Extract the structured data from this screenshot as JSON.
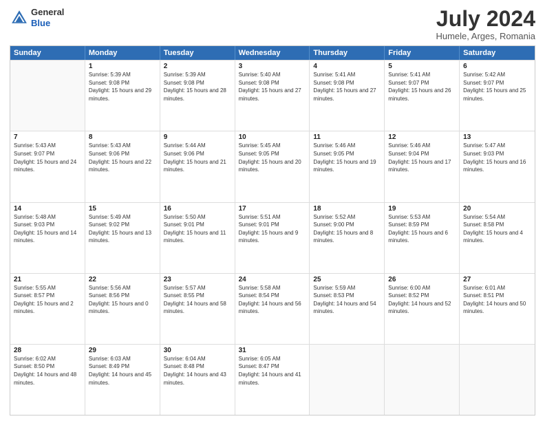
{
  "logo": {
    "line1": "General",
    "line2": "Blue"
  },
  "title": "July 2024",
  "location": "Humele, Arges, Romania",
  "days": [
    "Sunday",
    "Monday",
    "Tuesday",
    "Wednesday",
    "Thursday",
    "Friday",
    "Saturday"
  ],
  "weeks": [
    [
      {
        "day": "",
        "sunrise": "",
        "sunset": "",
        "daylight": ""
      },
      {
        "day": "1",
        "sunrise": "Sunrise: 5:39 AM",
        "sunset": "Sunset: 9:08 PM",
        "daylight": "Daylight: 15 hours and 29 minutes."
      },
      {
        "day": "2",
        "sunrise": "Sunrise: 5:39 AM",
        "sunset": "Sunset: 9:08 PM",
        "daylight": "Daylight: 15 hours and 28 minutes."
      },
      {
        "day": "3",
        "sunrise": "Sunrise: 5:40 AM",
        "sunset": "Sunset: 9:08 PM",
        "daylight": "Daylight: 15 hours and 27 minutes."
      },
      {
        "day": "4",
        "sunrise": "Sunrise: 5:41 AM",
        "sunset": "Sunset: 9:08 PM",
        "daylight": "Daylight: 15 hours and 27 minutes."
      },
      {
        "day": "5",
        "sunrise": "Sunrise: 5:41 AM",
        "sunset": "Sunset: 9:07 PM",
        "daylight": "Daylight: 15 hours and 26 minutes."
      },
      {
        "day": "6",
        "sunrise": "Sunrise: 5:42 AM",
        "sunset": "Sunset: 9:07 PM",
        "daylight": "Daylight: 15 hours and 25 minutes."
      }
    ],
    [
      {
        "day": "7",
        "sunrise": "Sunrise: 5:43 AM",
        "sunset": "Sunset: 9:07 PM",
        "daylight": "Daylight: 15 hours and 24 minutes."
      },
      {
        "day": "8",
        "sunrise": "Sunrise: 5:43 AM",
        "sunset": "Sunset: 9:06 PM",
        "daylight": "Daylight: 15 hours and 22 minutes."
      },
      {
        "day": "9",
        "sunrise": "Sunrise: 5:44 AM",
        "sunset": "Sunset: 9:06 PM",
        "daylight": "Daylight: 15 hours and 21 minutes."
      },
      {
        "day": "10",
        "sunrise": "Sunrise: 5:45 AM",
        "sunset": "Sunset: 9:05 PM",
        "daylight": "Daylight: 15 hours and 20 minutes."
      },
      {
        "day": "11",
        "sunrise": "Sunrise: 5:46 AM",
        "sunset": "Sunset: 9:05 PM",
        "daylight": "Daylight: 15 hours and 19 minutes."
      },
      {
        "day": "12",
        "sunrise": "Sunrise: 5:46 AM",
        "sunset": "Sunset: 9:04 PM",
        "daylight": "Daylight: 15 hours and 17 minutes."
      },
      {
        "day": "13",
        "sunrise": "Sunrise: 5:47 AM",
        "sunset": "Sunset: 9:03 PM",
        "daylight": "Daylight: 15 hours and 16 minutes."
      }
    ],
    [
      {
        "day": "14",
        "sunrise": "Sunrise: 5:48 AM",
        "sunset": "Sunset: 9:03 PM",
        "daylight": "Daylight: 15 hours and 14 minutes."
      },
      {
        "day": "15",
        "sunrise": "Sunrise: 5:49 AM",
        "sunset": "Sunset: 9:02 PM",
        "daylight": "Daylight: 15 hours and 13 minutes."
      },
      {
        "day": "16",
        "sunrise": "Sunrise: 5:50 AM",
        "sunset": "Sunset: 9:01 PM",
        "daylight": "Daylight: 15 hours and 11 minutes."
      },
      {
        "day": "17",
        "sunrise": "Sunrise: 5:51 AM",
        "sunset": "Sunset: 9:01 PM",
        "daylight": "Daylight: 15 hours and 9 minutes."
      },
      {
        "day": "18",
        "sunrise": "Sunrise: 5:52 AM",
        "sunset": "Sunset: 9:00 PM",
        "daylight": "Daylight: 15 hours and 8 minutes."
      },
      {
        "day": "19",
        "sunrise": "Sunrise: 5:53 AM",
        "sunset": "Sunset: 8:59 PM",
        "daylight": "Daylight: 15 hours and 6 minutes."
      },
      {
        "day": "20",
        "sunrise": "Sunrise: 5:54 AM",
        "sunset": "Sunset: 8:58 PM",
        "daylight": "Daylight: 15 hours and 4 minutes."
      }
    ],
    [
      {
        "day": "21",
        "sunrise": "Sunrise: 5:55 AM",
        "sunset": "Sunset: 8:57 PM",
        "daylight": "Daylight: 15 hours and 2 minutes."
      },
      {
        "day": "22",
        "sunrise": "Sunrise: 5:56 AM",
        "sunset": "Sunset: 8:56 PM",
        "daylight": "Daylight: 15 hours and 0 minutes."
      },
      {
        "day": "23",
        "sunrise": "Sunrise: 5:57 AM",
        "sunset": "Sunset: 8:55 PM",
        "daylight": "Daylight: 14 hours and 58 minutes."
      },
      {
        "day": "24",
        "sunrise": "Sunrise: 5:58 AM",
        "sunset": "Sunset: 8:54 PM",
        "daylight": "Daylight: 14 hours and 56 minutes."
      },
      {
        "day": "25",
        "sunrise": "Sunrise: 5:59 AM",
        "sunset": "Sunset: 8:53 PM",
        "daylight": "Daylight: 14 hours and 54 minutes."
      },
      {
        "day": "26",
        "sunrise": "Sunrise: 6:00 AM",
        "sunset": "Sunset: 8:52 PM",
        "daylight": "Daylight: 14 hours and 52 minutes."
      },
      {
        "day": "27",
        "sunrise": "Sunrise: 6:01 AM",
        "sunset": "Sunset: 8:51 PM",
        "daylight": "Daylight: 14 hours and 50 minutes."
      }
    ],
    [
      {
        "day": "28",
        "sunrise": "Sunrise: 6:02 AM",
        "sunset": "Sunset: 8:50 PM",
        "daylight": "Daylight: 14 hours and 48 minutes."
      },
      {
        "day": "29",
        "sunrise": "Sunrise: 6:03 AM",
        "sunset": "Sunset: 8:49 PM",
        "daylight": "Daylight: 14 hours and 45 minutes."
      },
      {
        "day": "30",
        "sunrise": "Sunrise: 6:04 AM",
        "sunset": "Sunset: 8:48 PM",
        "daylight": "Daylight: 14 hours and 43 minutes."
      },
      {
        "day": "31",
        "sunrise": "Sunrise: 6:05 AM",
        "sunset": "Sunset: 8:47 PM",
        "daylight": "Daylight: 14 hours and 41 minutes."
      },
      {
        "day": "",
        "sunrise": "",
        "sunset": "",
        "daylight": ""
      },
      {
        "day": "",
        "sunrise": "",
        "sunset": "",
        "daylight": ""
      },
      {
        "day": "",
        "sunrise": "",
        "sunset": "",
        "daylight": ""
      }
    ]
  ]
}
